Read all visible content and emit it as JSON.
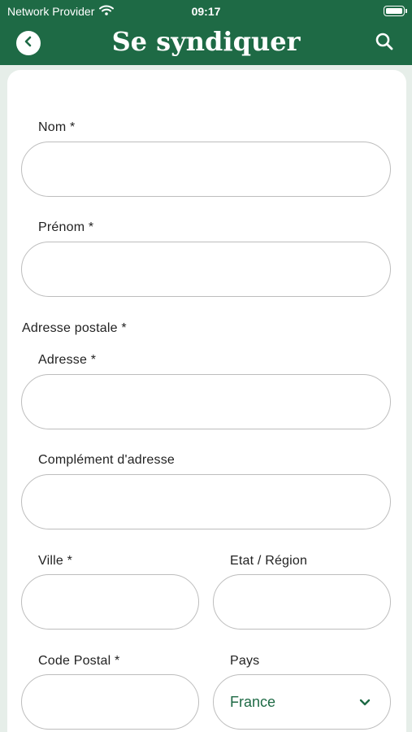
{
  "status_bar": {
    "carrier": "Network Provider",
    "time": "09:17"
  },
  "nav": {
    "title": "Se syndiquer"
  },
  "form": {
    "nom": {
      "label": "Nom *",
      "value": ""
    },
    "prenom": {
      "label": "Prénom *",
      "value": ""
    },
    "adresse_postale_heading": "Adresse postale *",
    "adresse": {
      "label": "Adresse *",
      "value": ""
    },
    "complement": {
      "label": "Complément d'adresse",
      "value": ""
    },
    "ville": {
      "label": "Ville *",
      "value": ""
    },
    "etat": {
      "label": "Etat / Région",
      "value": ""
    },
    "code_postal": {
      "label": "Code Postal *",
      "value": ""
    },
    "pays": {
      "label": "Pays",
      "selected": "France"
    }
  },
  "colors": {
    "brand_green": "#1e6a45",
    "background": "#e6eee9",
    "field_border": "#bdbdbd"
  }
}
